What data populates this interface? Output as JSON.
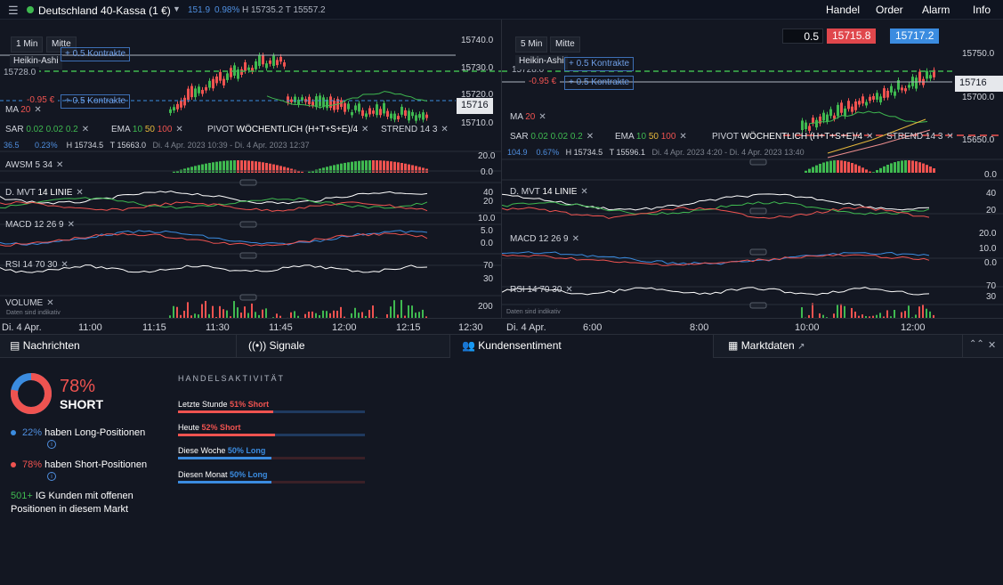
{
  "header": {
    "market": "Deutschland 40-Kassa (1 €)",
    "change": "151.9",
    "change_pct": "0.98%",
    "high_low": "H 15735.2  T 15557.2",
    "nav": [
      "Handel",
      "Order",
      "Alarm",
      "Info"
    ]
  },
  "colors": {
    "up": "#3fb950",
    "down": "#ef5350",
    "accent": "#4f8fe0",
    "bg": "#131722"
  },
  "left": {
    "interval": "1 Min",
    "mode": "Mitte",
    "chart_type": "Heikin-Ashi",
    "contracts": "+ 0.5 Kontrakte",
    "contracts2": "+ 0.5 Kontrakte",
    "pos_level": "15728.0",
    "pnl": "-0.95 €",
    "current_price": "15716",
    "price_levels": [
      "15740.0",
      "15730.0",
      "15720.0",
      "15710.0"
    ],
    "ma": {
      "name": "MA",
      "val": "20"
    },
    "sar": {
      "name": "SAR",
      "a": "0.02",
      "b": "0.02",
      "c": "0.2"
    },
    "ema": {
      "name": "EMA",
      "a": "10",
      "b": "50",
      "c": "100"
    },
    "pivot": {
      "name": "PIVOT",
      "val": "WÖCHENTLICH",
      "formula": "(H+T+S+E)/4"
    },
    "strend": {
      "name": "STREND",
      "a": "14",
      "b": "3"
    },
    "stats": {
      "chg": "36.5",
      "pct": "0.23%",
      "high": "H 15734.5",
      "low": "T 15663.0",
      "range": "Di. 4 Apr. 2023 10:39 - Di. 4 Apr. 2023 12:37"
    },
    "awsm": {
      "name": "AWSM",
      "a": "5",
      "b": "34",
      "level": "20.0",
      "zero": "0.0"
    },
    "dmvt": {
      "name": "D. MVT",
      "a": "14",
      "b": "LINIE",
      "l1": "40",
      "l2": "20"
    },
    "macd": {
      "name": "MACD",
      "a": "12",
      "b": "26",
      "c": "9",
      "l1": "10.0",
      "l2": "5.0",
      "l3": "0.0"
    },
    "rsi": {
      "name": "RSI",
      "a": "14",
      "b": "70",
      "c": "30",
      "l1": "70",
      "l2": "30"
    },
    "volume": {
      "name": "VOLUME",
      "level": "200",
      "note": "Daten sind indikativ"
    },
    "xaxis": [
      "Di. 4 Apr.",
      "11:00",
      "11:15",
      "11:30",
      "11:45",
      "12:00",
      "12:15",
      "12:30"
    ]
  },
  "right": {
    "interval": "5 Min",
    "mode": "Mitte",
    "chart_type": "Heikin-Ashi",
    "contracts": "+ 0.5 Kontrakte",
    "contracts2": "+ 0.5 Kontrakte",
    "pos_level": "15728.0",
    "pnl": "-0.95 €",
    "current_price": "15716",
    "qty": "0.5",
    "sell": "15715.8",
    "buy": "15717.2",
    "price_levels": [
      "15750.0",
      "15700.0",
      "15650.0"
    ],
    "ma": {
      "name": "MA",
      "val": "20"
    },
    "sar": {
      "name": "SAR",
      "a": "0.02",
      "b": "0.02",
      "c": "0.2"
    },
    "ema": {
      "name": "EMA",
      "a": "10",
      "b": "50",
      "c": "100"
    },
    "pivot": {
      "name": "PIVOT",
      "val": "WÖCHENTLICH",
      "formula": "(H+T+S+E)/4"
    },
    "strend": {
      "name": "STREND",
      "a": "14",
      "b": "3"
    },
    "stats": {
      "chg": "104.9",
      "pct": "0.67%",
      "high": "H 15734.5",
      "low": "T 15596.1",
      "range": "Di. 4 Apr. 2023 4:20 - Di. 4 Apr. 2023 13:40"
    },
    "awsm": {
      "zero": "0.0"
    },
    "dmvt": {
      "name": "D. MVT",
      "a": "14",
      "b": "LINIE",
      "l1": "40",
      "l2": "20"
    },
    "macd": {
      "name": "MACD",
      "a": "12",
      "b": "26",
      "c": "9",
      "l1": "20.0",
      "l2": "10.0",
      "l3": "0.0"
    },
    "rsi": {
      "name": "RSI",
      "a": "14",
      "b": "70",
      "c": "30",
      "l1": "70",
      "l2": "30"
    },
    "volume": {
      "note": "Daten sind indikativ"
    },
    "xaxis": [
      "Di. 4 Apr.",
      "6:00",
      "8:00",
      "10:00",
      "12:00"
    ]
  },
  "tabs": {
    "news": "Nachrichten",
    "signals": "Signale",
    "sentiment": "Kundensentiment",
    "market": "Marktdaten"
  },
  "sentiment": {
    "pct": "78%",
    "side": "SHORT",
    "short_fraction": 0.78,
    "long_pct": "22%",
    "long_text": "haben Long-Positionen",
    "short_pct": "78%",
    "short_text": "haben Short-Positionen",
    "clients": "501+",
    "clients_text": "IG Kunden mit offenen",
    "clients_text2": "Positionen in diesem Markt"
  },
  "activity": {
    "heading": "HANDELSAKTIVITÄT",
    "rows": [
      {
        "label": "Letzte Stunde",
        "value": "51% Short",
        "side": "short",
        "fraction": 0.51
      },
      {
        "label": "Heute",
        "value": "52% Short",
        "side": "short",
        "fraction": 0.52
      },
      {
        "label": "Diese Woche",
        "value": "50% Long",
        "side": "long",
        "fraction": 0.5
      },
      {
        "label": "Diesen Monat",
        "value": "50% Long",
        "side": "long",
        "fraction": 0.5
      }
    ]
  }
}
